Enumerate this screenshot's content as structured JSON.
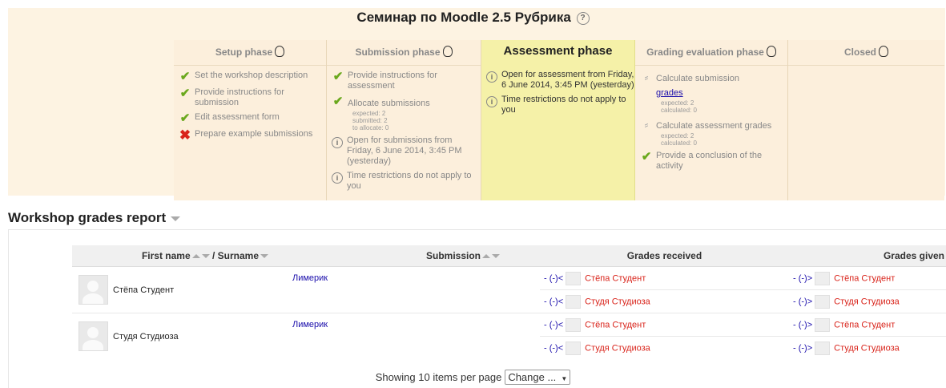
{
  "workshop_title": "Семинар по Moodle 2.5 Рубрика",
  "phases": [
    {
      "name": "Setup phase",
      "tasks": [
        {
          "status": "ok",
          "text": "Set the workshop description"
        },
        {
          "status": "ok",
          "text": "Provide instructions for submission"
        },
        {
          "status": "ok",
          "text": "Edit assessment form"
        },
        {
          "status": "fail",
          "text": "Prepare example submissions"
        }
      ]
    },
    {
      "name": "Submission phase",
      "tasks": [
        {
          "status": "ok",
          "text": "Provide instructions for assessment"
        },
        {
          "status": "ok",
          "text": "Allocate submissions",
          "details": [
            "expected: 2",
            "submitted: 2",
            "to allocate: 0"
          ]
        },
        {
          "status": "info",
          "text": "Open for submissions from Friday, 6 June 2014, 3:45 PM (yesterday)"
        },
        {
          "status": "info",
          "text": "Time restrictions do not apply to you"
        }
      ]
    },
    {
      "name": "Assessment phase",
      "tasks": [
        {
          "status": "info",
          "text": "Open for assessment from Friday, 6 June 2014, 3:45 PM (yesterday)"
        },
        {
          "status": "info",
          "text": "Time restrictions do not apply to you"
        }
      ]
    },
    {
      "name": "Grading evaluation phase",
      "tasks": [
        {
          "status": "todo",
          "text": "Calculate submission",
          "link": "grades",
          "details": [
            "expected: 2",
            "calculated: 0"
          ]
        },
        {
          "status": "todo",
          "text": "Calculate assessment grades",
          "details": [
            "expected: 2",
            "calculated: 0"
          ]
        },
        {
          "status": "ok",
          "text": "Provide a conclusion of the activity"
        }
      ]
    },
    {
      "name": "Closed",
      "tasks": []
    }
  ],
  "report": {
    "title": "Workshop grades report",
    "headers": {
      "firstname": "First name",
      "surname": "/ Surname",
      "submission": "Submission",
      "received": "Grades received",
      "given": "Grades given"
    },
    "rows": [
      {
        "user": "Стёпа Студент",
        "submission": "Лимерик",
        "received": [
          {
            "grade": "- (-)<",
            "name": "Стёпа Студент"
          },
          {
            "grade": "- (-)<",
            "name": "Студя Студиоза"
          }
        ],
        "given": [
          {
            "grade": "- (-)>",
            "name": "Стёпа Студент"
          },
          {
            "grade": "- (-)>",
            "name": "Студя Студиоза"
          }
        ]
      },
      {
        "user": "Студя Студиоза",
        "submission": "Лимерик",
        "received": [
          {
            "grade": "- (-)<",
            "name": "Стёпа Студент"
          },
          {
            "grade": "- (-)<",
            "name": "Студя Студиоза"
          }
        ],
        "given": [
          {
            "grade": "- (-)>",
            "name": "Стёпа Студент"
          },
          {
            "grade": "- (-)>",
            "name": "Студя Студиоза"
          }
        ]
      }
    ]
  },
  "footer": {
    "label": "Showing 10 items per page",
    "select_value": "Change ..."
  }
}
